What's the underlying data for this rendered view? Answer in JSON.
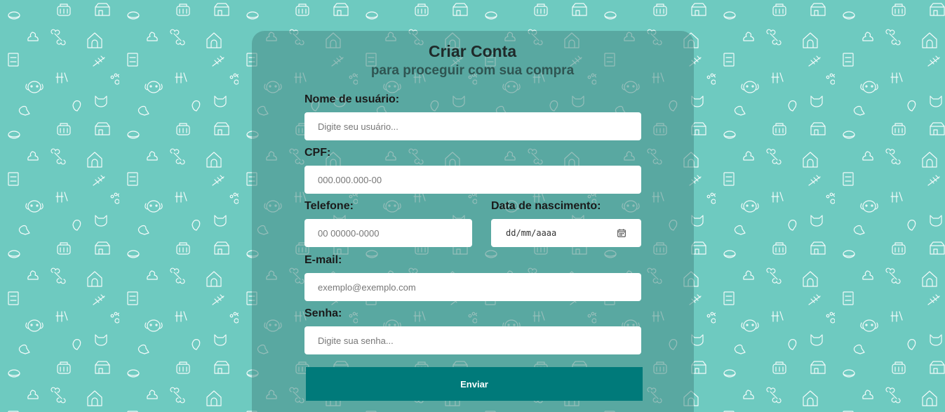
{
  "header": {
    "title": "Criar Conta",
    "subtitle": "para proceguir com sua compra"
  },
  "form": {
    "username": {
      "label": "Nome de usuário:",
      "placeholder": "Digite seu usuário..."
    },
    "cpf": {
      "label": "CPF:",
      "placeholder": "000.000.000-00"
    },
    "phone": {
      "label": "Telefone:",
      "placeholder": "00 00000-0000"
    },
    "birthdate": {
      "label": "Data de nascimento:",
      "placeholder": "dd/mm/aaaa"
    },
    "email": {
      "label": "E-mail:",
      "placeholder": "exemplo@exemplo.com"
    },
    "password": {
      "label": "Senha:",
      "placeholder": "Digite sua senha..."
    },
    "submit_label": "Enviar"
  },
  "icons": {
    "background_pattern": [
      "pet-carrier-icon",
      "pet-shop-icon",
      "food-bowl-icon",
      "bone-icon",
      "dog-house-icon",
      "poop-icon",
      "pet-food-bag-icon",
      "fish-bone-icon",
      "grooming-icon",
      "paw-icon",
      "dog-face-icon",
      "cat-face-icon",
      "bird-icon",
      "sitting-dog-icon"
    ],
    "date_picker": "calendar-icon"
  },
  "colors": {
    "background": "#6ecac0",
    "card": "#4f9e97",
    "button": "#007a7a",
    "button_text": "#ffffff",
    "field": "#ffffff"
  }
}
